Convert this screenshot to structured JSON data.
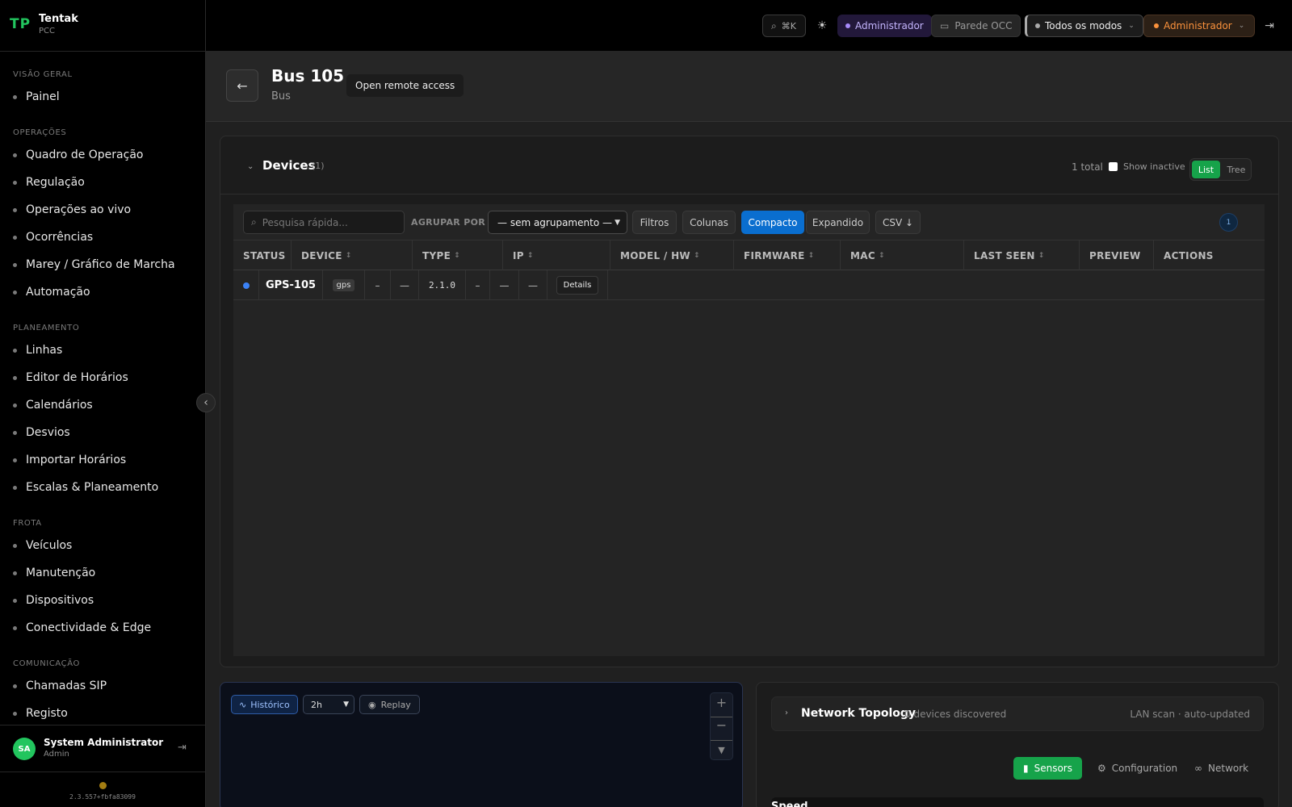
{
  "brand": {
    "logo": "TP",
    "name": "Tentak",
    "sub": "PCC"
  },
  "nav": {
    "sections": [
      {
        "title": "VISÃO GERAL",
        "items": [
          "Painel"
        ]
      },
      {
        "title": "OPERAÇÕES",
        "items": [
          "Quadro de Operação",
          "Regulação",
          "Operações ao vivo",
          "Ocorrências",
          "Marey / Gráfico de Marcha",
          "Automação"
        ]
      },
      {
        "title": "PLANEAMENTO",
        "items": [
          "Linhas",
          "Editor de Horários",
          "Calendários",
          "Desvios",
          "Importar Horários",
          "Escalas & Planeamento"
        ]
      },
      {
        "title": "FROTA",
        "items": [
          "Veículos",
          "Manutenção",
          "Dispositivos",
          "Conectividade & Edge"
        ]
      },
      {
        "title": "COMUNICAÇÃO",
        "items": [
          "Chamadas SIP",
          "Registo"
        ]
      }
    ]
  },
  "user": {
    "initials": "SA",
    "name": "System Administrator",
    "role": "Admin"
  },
  "version": "2.3.557+fbfa83099",
  "topbar": {
    "search_hint": "⌘K",
    "admin_badge": "Administrador",
    "wall_label": "Parede OCC",
    "modes_label": "Todos os modos",
    "role_label": "Administrador",
    "colors": {
      "admin": "#a78bfa",
      "role": "#fb923c"
    }
  },
  "header": {
    "title": "Bus 105",
    "subtitle": "Bus",
    "remote_label": "Open remote access"
  },
  "devices": {
    "title": "Devices",
    "count": "(1)",
    "total": "1 total",
    "show_inactive": "Show inactive",
    "view_list": "List",
    "view_tree": "Tree",
    "toolbar": {
      "search_placeholder": "Pesquisa rápida...",
      "group_label": "AGRUPAR POR",
      "group_value": "— sem agrupamento —",
      "filters": "Filtros",
      "columns": "Colunas",
      "compact": "Compacto",
      "expanded": "Expandido",
      "csv": "CSV ↓",
      "count_badge": "1"
    },
    "columns": [
      "STATUS",
      "DEVICE",
      "TYPE",
      "IP",
      "MODEL / HW",
      "FIRMWARE",
      "MAC",
      "LAST SEEN",
      "PREVIEW",
      "ACTIONS"
    ],
    "rows": [
      {
        "status_color": "#3b82f6",
        "device": "GPS-105",
        "type": "gps",
        "c1": "–",
        "c2": "—",
        "firmware": "2.1.0",
        "c3": "–",
        "c4": "—",
        "c5": "—",
        "action": "Details"
      }
    ]
  },
  "history": {
    "hist_label": "Histórico",
    "range_value": "2h",
    "replay_label": "Replay"
  },
  "network": {
    "title": "Network Topology",
    "count": "0 devices discovered",
    "right": "LAN scan · auto-updated",
    "tabs": [
      {
        "icon": "📊",
        "label": "Sensors"
      },
      {
        "icon": "⚙️",
        "label": "Configuration"
      },
      {
        "icon": "🔗",
        "label": "Network"
      }
    ],
    "speed_label": "Speed"
  }
}
